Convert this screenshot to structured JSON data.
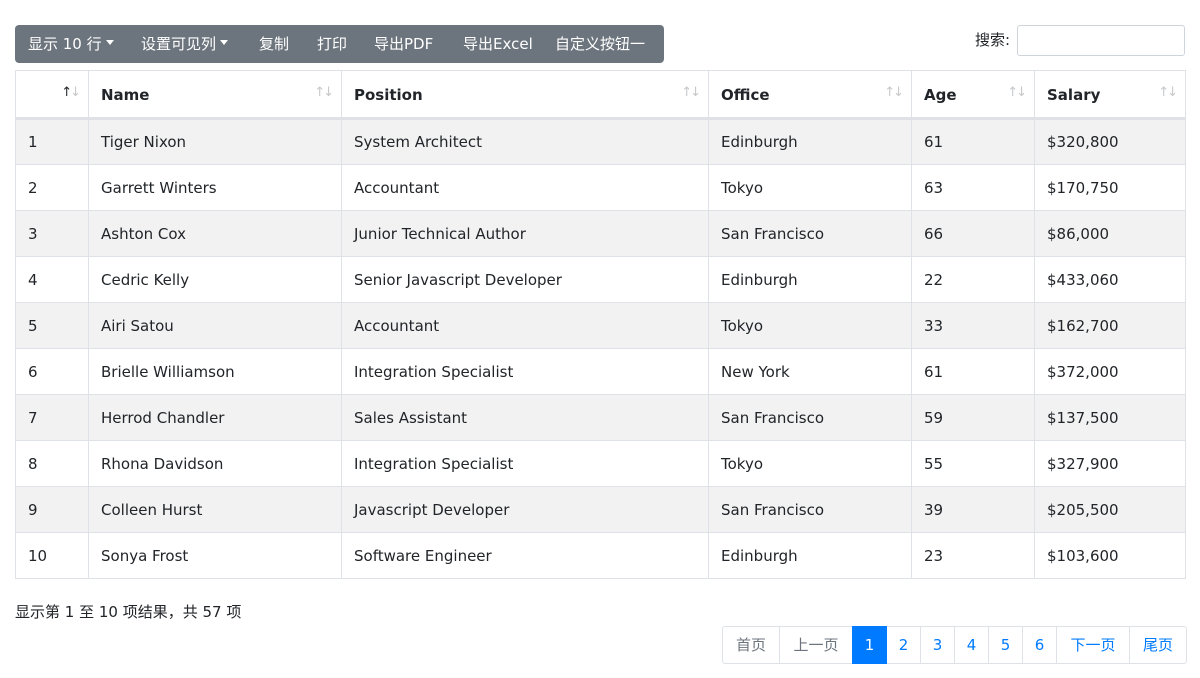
{
  "toolbar": {
    "show_rows_label": "显示 10 行",
    "column_visibility_label": "设置可见列",
    "copy_label": "复制",
    "print_label": "打印",
    "export_pdf_label": "导出PDF",
    "export_excel_label": "导出Excel",
    "custom_button_label": "自定义按钮一"
  },
  "search": {
    "label": "搜索:",
    "value": ""
  },
  "table": {
    "headers": [
      "",
      "Name",
      "Position",
      "Office",
      "Age",
      "Salary"
    ],
    "rows": [
      [
        "1",
        "Tiger Nixon",
        "System Architect",
        "Edinburgh",
        "61",
        "$320,800"
      ],
      [
        "2",
        "Garrett Winters",
        "Accountant",
        "Tokyo",
        "63",
        "$170,750"
      ],
      [
        "3",
        "Ashton Cox",
        "Junior Technical Author",
        "San Francisco",
        "66",
        "$86,000"
      ],
      [
        "4",
        "Cedric Kelly",
        "Senior Javascript Developer",
        "Edinburgh",
        "22",
        "$433,060"
      ],
      [
        "5",
        "Airi Satou",
        "Accountant",
        "Tokyo",
        "33",
        "$162,700"
      ],
      [
        "6",
        "Brielle Williamson",
        "Integration Specialist",
        "New York",
        "61",
        "$372,000"
      ],
      [
        "7",
        "Herrod Chandler",
        "Sales Assistant",
        "San Francisco",
        "59",
        "$137,500"
      ],
      [
        "8",
        "Rhona Davidson",
        "Integration Specialist",
        "Tokyo",
        "55",
        "$327,900"
      ],
      [
        "9",
        "Colleen Hurst",
        "Javascript Developer",
        "San Francisco",
        "39",
        "$205,500"
      ],
      [
        "10",
        "Sonya Frost",
        "Software Engineer",
        "Edinburgh",
        "23",
        "$103,600"
      ]
    ],
    "sort_icon": "sort-arrows-icon"
  },
  "info": {
    "text": "显示第 1 至 10 项结果，共 57 项"
  },
  "pagination": {
    "first": "首页",
    "previous": "上一页",
    "pages": [
      "1",
      "2",
      "3",
      "4",
      "5",
      "6"
    ],
    "current": "1",
    "next": "下一页",
    "last": "尾页"
  },
  "colors": {
    "toolbar_bg": "#6c757d",
    "accent": "#007bff",
    "stripe": "#f2f2f2",
    "border": "#dee2e6"
  }
}
